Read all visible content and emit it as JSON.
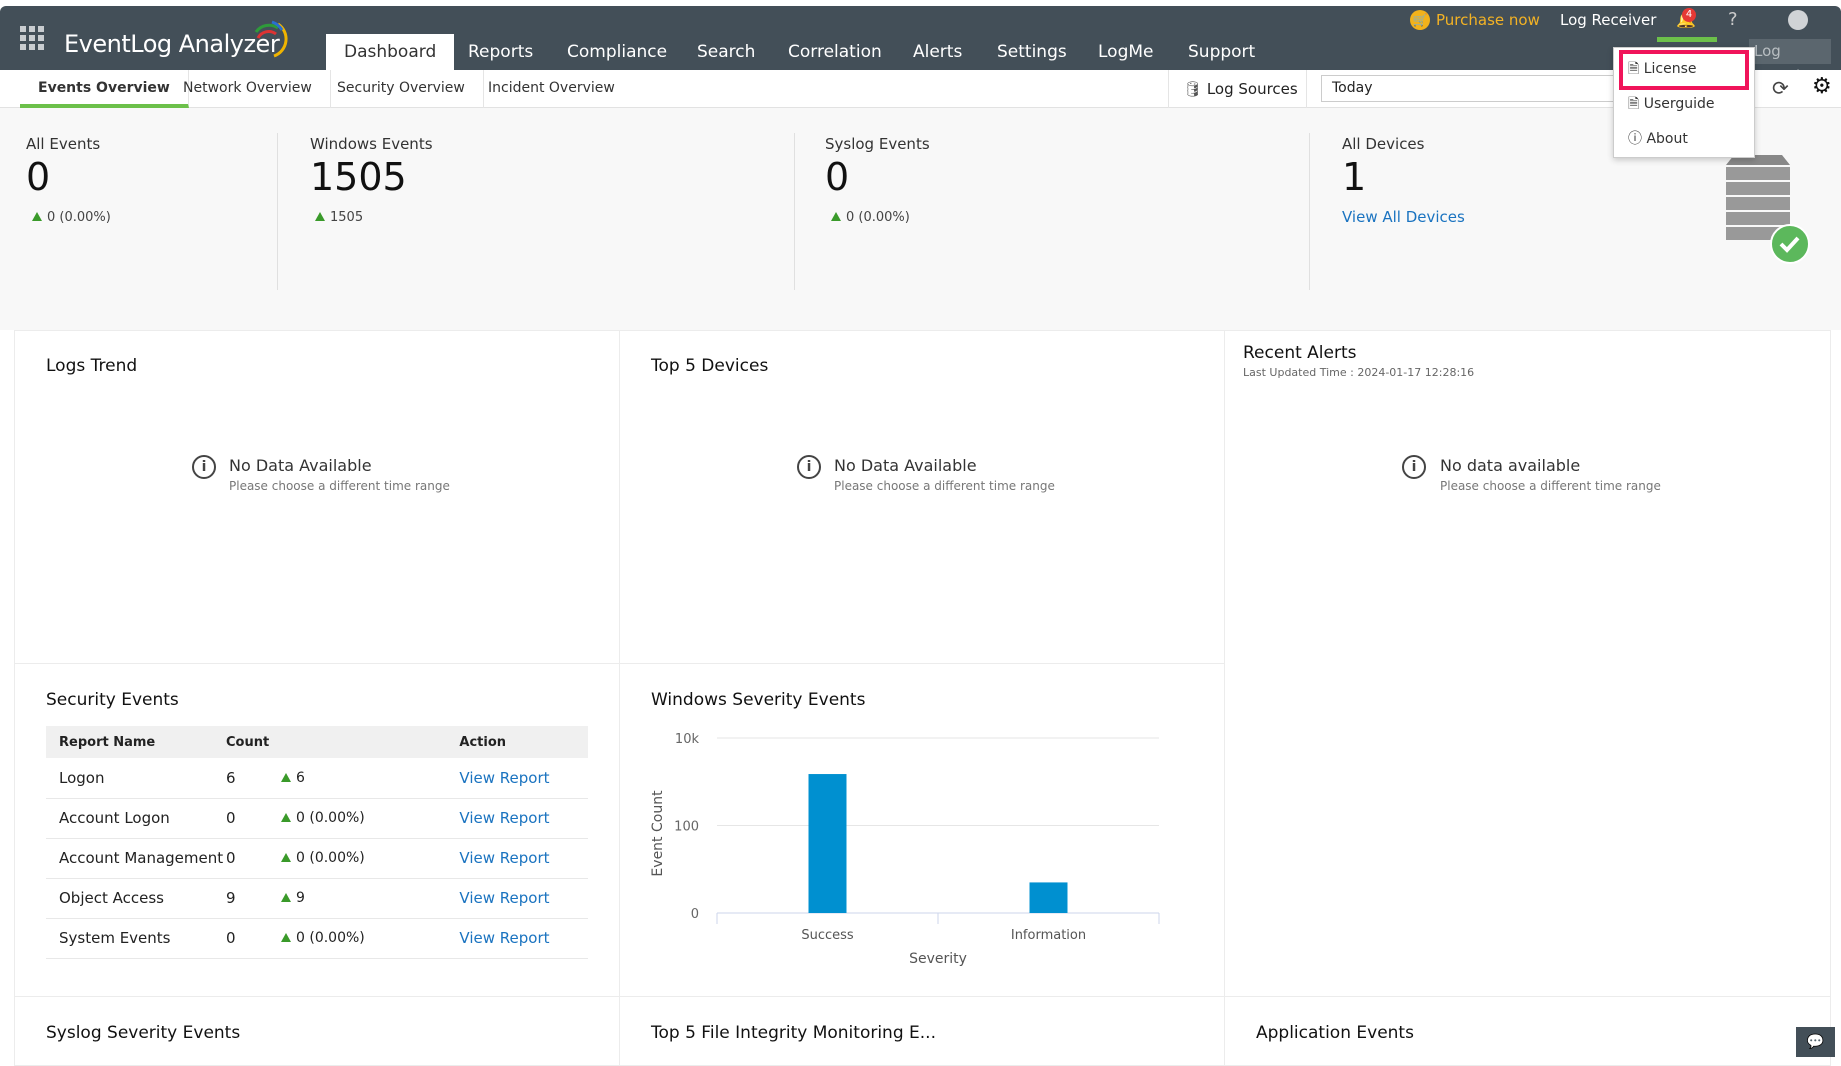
{
  "app": {
    "title": "EventLog Analyzer"
  },
  "nav": [
    "Dashboard",
    "Reports",
    "Compliance",
    "Search",
    "Correlation",
    "Alerts",
    "Settings",
    "LogMe",
    "Support"
  ],
  "top_right": {
    "purchase": "Purchase now",
    "log_receiver": "Log Receiver",
    "notification_count": "4",
    "help": "?",
    "log_search": "Log Search"
  },
  "help_menu": {
    "items": [
      "License",
      "Userguide",
      "About"
    ],
    "highlighted": "License",
    "highlight_color": "#f0145a"
  },
  "subnav": {
    "tabs": [
      "Events Overview",
      "Network Overview",
      "Security Overview",
      "Incident Overview"
    ],
    "log_sources": "Log Sources",
    "time_range": "Today"
  },
  "stats": [
    {
      "label": "All Events",
      "value": "0",
      "delta": "0 (0.00%)"
    },
    {
      "label": "Windows Events",
      "value": "1505",
      "delta": "1505"
    },
    {
      "label": "Syslog Events",
      "value": "0",
      "delta": "0 (0.00%)"
    },
    {
      "label": "All Devices",
      "value": "1",
      "link": "View All Devices"
    }
  ],
  "panels": {
    "logs_trend": {
      "title": "Logs Trend",
      "nodata": "No Data Available",
      "hint": "Please choose a different time range"
    },
    "top_devices": {
      "title": "Top 5 Devices",
      "nodata": "No Data Available",
      "hint": "Please choose a different time range"
    },
    "recent_alerts": {
      "title": "Recent Alerts",
      "updated": "Last Updated Time : 2024-01-17 12:28:16",
      "nodata": "No data available",
      "hint": "Please choose a different time range"
    },
    "security_events": {
      "title": "Security Events",
      "columns": [
        "Report Name",
        "Count",
        "Action"
      ],
      "rows": [
        {
          "name": "Logon",
          "count": "6",
          "delta": "6",
          "action": "View Report"
        },
        {
          "name": "Account Logon",
          "count": "0",
          "delta": "0 (0.00%)",
          "action": "View Report"
        },
        {
          "name": "Account Management",
          "count": "0",
          "delta": "0 (0.00%)",
          "action": "View Report"
        },
        {
          "name": "Object Access",
          "count": "9",
          "delta": "9",
          "action": "View Report"
        },
        {
          "name": "System Events",
          "count": "0",
          "delta": "0 (0.00%)",
          "action": "View Report"
        }
      ]
    },
    "syslog_severity": {
      "title": "Syslog Severity Events"
    },
    "fim": {
      "title": "Top 5 File Integrity Monitoring E..."
    },
    "app_events": {
      "title": "Application Events"
    }
  },
  "chart_data": {
    "type": "bar",
    "title": "Windows Severity Events",
    "categories": [
      "Success",
      "Information"
    ],
    "values": [
      1500,
      5
    ],
    "xlabel": "Severity",
    "ylabel": "Event Count",
    "yscale": "log",
    "ytick_values": [
      1,
      100,
      10000
    ],
    "ytick_labels": [
      "0",
      "100",
      "10k"
    ],
    "grid": true,
    "color": "#0090d0"
  }
}
